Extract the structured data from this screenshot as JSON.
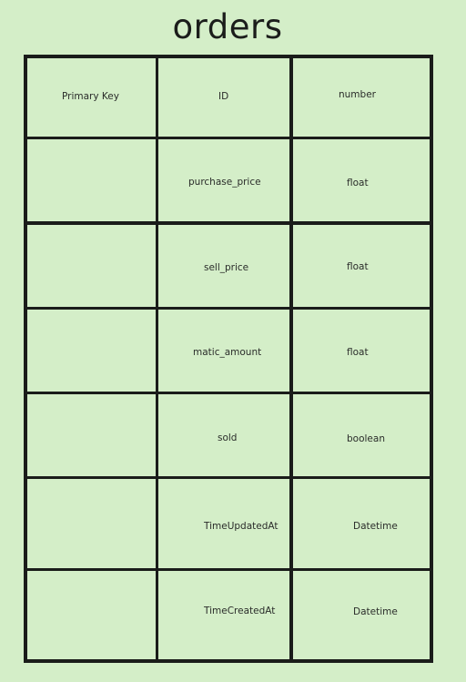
{
  "entity": {
    "name": "orders"
  },
  "columns": [
    {
      "key": "Primary Key",
      "field": "ID",
      "type": "number"
    },
    {
      "key": "",
      "field": "purchase_price",
      "type": "float"
    },
    {
      "key": "",
      "field": "sell_price",
      "type": "float"
    },
    {
      "key": "",
      "field": "matic_amount",
      "type": "float"
    },
    {
      "key": "",
      "field": "sold",
      "type": "boolean"
    },
    {
      "key": "",
      "field": "TimeUpdatedAt",
      "type": "Datetime"
    },
    {
      "key": "",
      "field": "TimeCreatedAt",
      "type": "Datetime"
    }
  ]
}
